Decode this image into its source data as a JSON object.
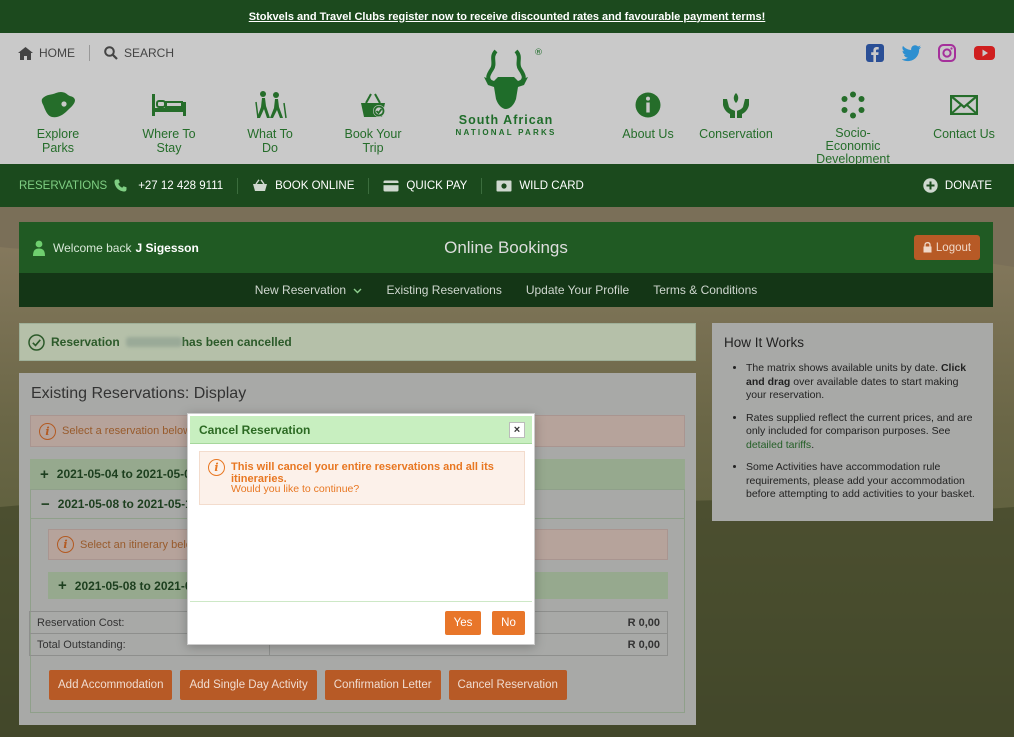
{
  "promo": {
    "text": "Stokvels and Travel Clubs register now to receive discounted rates and favourable payment terms!"
  },
  "utility": {
    "home": "HOME",
    "search": "SEARCH"
  },
  "nav": {
    "explore": "Explore Parks",
    "stay": "Where To Stay",
    "todo": "What To Do",
    "book": "Book Your Trip",
    "about": "About Us",
    "conservation": "Conservation",
    "socio1": "Socio-Economic",
    "socio2": "Development",
    "contact": "Contact Us"
  },
  "logo": {
    "line1": "South African",
    "line2": "NATIONAL PARKS",
    "reg": "®"
  },
  "resbar": {
    "reservations": "RESERVATIONS",
    "phone": "+27 12 428 9111",
    "book_online": "BOOK ONLINE",
    "quick_pay": "QUICK PAY",
    "wild_card": "WILD CARD",
    "donate": "DONATE"
  },
  "booking": {
    "welcome": "Welcome back",
    "user": "J Sigesson",
    "title": "Online Bookings",
    "logout": "Logout"
  },
  "subnav": {
    "new_res": "New Reservation",
    "existing": "Existing Reservations",
    "profile": "Update Your Profile",
    "terms": "Terms & Conditions"
  },
  "success": {
    "prefix": "Reservation",
    "suffix": "has been cancelled"
  },
  "existing": {
    "title": "Existing Reservations: Display",
    "select_msg": "Select a reservation below to",
    "acc1": "2021-05-04 to 2021-05-0",
    "acc2": "2021-05-08 to 2021-05-1",
    "itinerary_msg": "Select an itinerary below",
    "itin1": "2021-05-08 to 2021-05",
    "cost_label": "Reservation Cost:",
    "cost_value": "R 0,00",
    "outstanding_label": "Total Outstanding:",
    "outstanding_value": "R 0,00",
    "buttons": {
      "add_accommodation": "Add Accommodation",
      "add_day": "Add Single Day Activity",
      "confirmation": "Confirmation Letter",
      "cancel": "Cancel Reservation"
    }
  },
  "how": {
    "title": "How It Works",
    "b1a": "The matrix shows available units by date.",
    "b1b": "Click and drag",
    "b1c": "over available dates to start making your reservation.",
    "b2a": "Rates supplied reflect the current prices, and are only included for comparison purposes. See",
    "b2link": "detailed tariffs",
    "b2b": ".",
    "b3": "Some Activities have accommodation rule requirements, please add your accommodation before attempting to add activities to your basket."
  },
  "modal": {
    "title": "Cancel Reservation",
    "close": "×",
    "warning": "This will cancel your entire reservations and all its itineraries.",
    "question": "Would you like to continue?",
    "yes": "Yes",
    "no": "No"
  },
  "colors": {
    "brand_green": "#1b4a1d",
    "accent_orange": "#e8762a"
  }
}
